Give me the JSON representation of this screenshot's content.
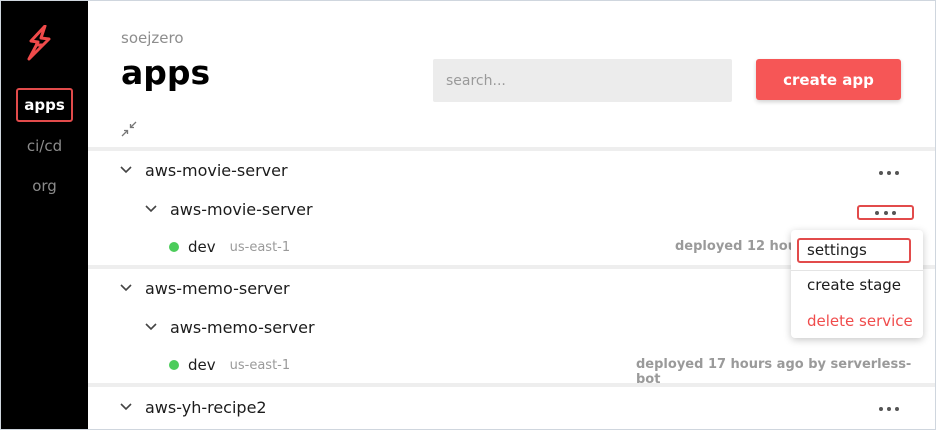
{
  "sidebar": {
    "logo_icon": "lightning-bolt-logo",
    "items": [
      {
        "label": "apps",
        "active": true
      },
      {
        "label": "ci/cd",
        "active": false
      },
      {
        "label": "org",
        "active": false
      }
    ]
  },
  "header": {
    "org_name": "soejzero",
    "title": "apps",
    "search_placeholder": "search...",
    "create_label": "create app"
  },
  "apps": [
    {
      "name": "aws-movie-server",
      "service": "aws-movie-server",
      "stage": "dev",
      "region": "us-east-1",
      "deploy_text": "deployed 12 hours"
    },
    {
      "name": "aws-memo-server",
      "service": "aws-memo-server",
      "stage": "dev",
      "region": "us-east-1",
      "deploy_text": "deployed 17 hours ago by serverless-bot"
    },
    {
      "name": "aws-yh-recipe2"
    }
  ],
  "menu": {
    "settings": "settings",
    "create_stage": "create stage",
    "delete_service": "delete service"
  },
  "colors": {
    "accent": "#f65656",
    "highlight_box": "#e24b4b",
    "stage_ok": "#4ccc5b",
    "sidebar_bg": "#000000"
  }
}
